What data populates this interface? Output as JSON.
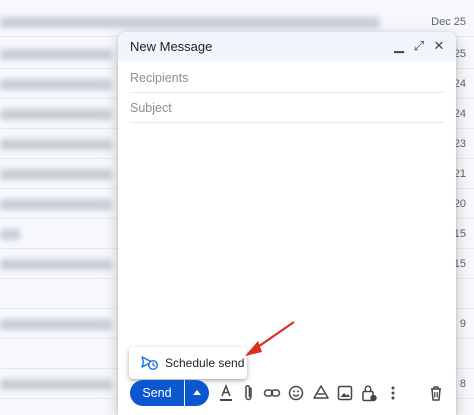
{
  "inbox": {
    "rows": [
      {
        "date": "Dec 25"
      },
      {
        "date": "25"
      },
      {
        "date": "24"
      },
      {
        "date": "24"
      },
      {
        "date": "23"
      },
      {
        "date": "21"
      },
      {
        "date": "20"
      },
      {
        "date": "15"
      },
      {
        "date": "15"
      },
      {
        "date": ""
      },
      {
        "date": "9"
      },
      {
        "date": ""
      },
      {
        "date": "8"
      }
    ]
  },
  "compose": {
    "title": "New Message",
    "controls": {
      "minimize": "▁",
      "expand": "⤢",
      "close": "✕"
    },
    "recipients_placeholder": "Recipients",
    "subject_placeholder": "Subject"
  },
  "schedule_popup": {
    "label": "Schedule send",
    "icon": "schedule-send-icon"
  },
  "toolbar": {
    "send_label": "Send",
    "tools": [
      "format-text-icon",
      "attach-icon",
      "link-icon",
      "emoji-icon",
      "drive-icon",
      "photo-icon",
      "confidential-lock-icon",
      "more-options-icon",
      "discard-icon"
    ]
  },
  "colors": {
    "accent": "#0b57d0",
    "arrow": "#d93025",
    "header_bg": "#f2f6fc"
  }
}
